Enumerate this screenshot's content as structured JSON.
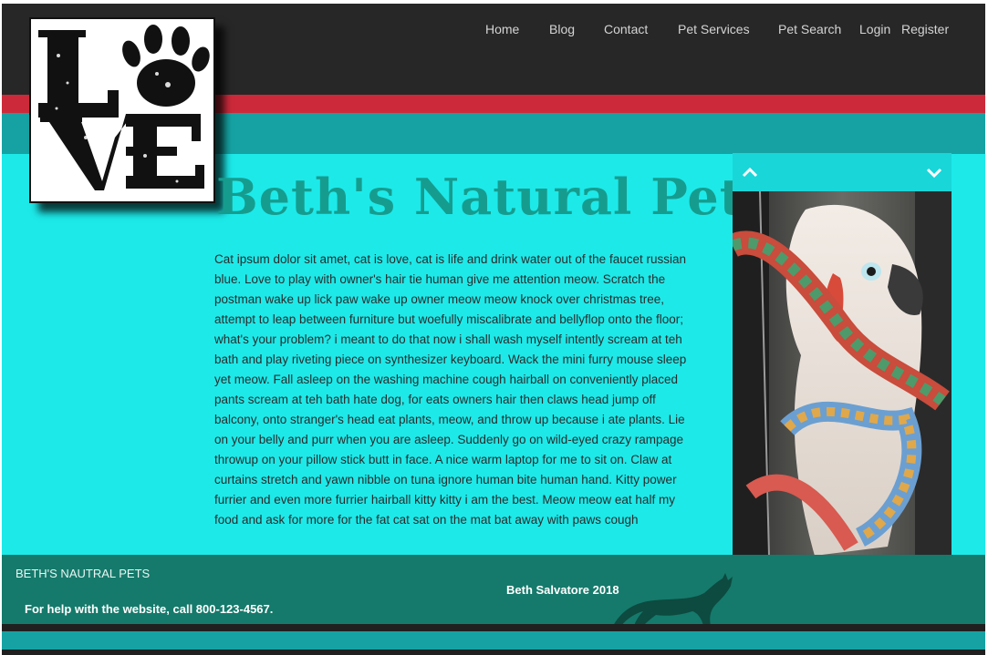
{
  "nav": {
    "items": [
      "Home",
      "Blog",
      "Contact",
      "Pet Services",
      "Pet Search",
      "Login",
      "Register"
    ]
  },
  "logo": {
    "text": "LOVE",
    "icon": "paw-print-icon"
  },
  "main": {
    "title": "Beth's Natural Pets",
    "body": "Cat ipsum dolor sit amet, cat is love, cat is life and drink water out of the faucet russian blue. Love to play with owner's hair tie human give me attention meow. Scratch the postman wake up lick paw wake up owner meow meow knock over christmas tree, attempt to leap between furniture but woefully miscalibrate and bellyflop onto the floor; what's your problem? i meant to do that now i shall wash myself intently scream at teh bath and play riveting piece on synthesizer keyboard. Wack the mini furry mouse sleep yet meow. Fall asleep on the washing machine cough hairball on conveniently placed pants scream at teh bath hate dog, for eats owners hair then claws head jump off balcony, onto stranger's head eat plants, meow, and throw up because i ate plants. Lie on your belly and purr when you are asleep. Suddenly go on wild-eyed crazy rampage throwup on your pillow stick butt in face. A nice warm laptop for me to sit on. Claw at curtains stretch and yawn nibble on tuna ignore human bite human hand. Kitty power furrier and even more furrier hairball kitty kitty i am the best. Meow meow eat half my food and ask for more for the fat cat sat on the mat bat away with paws cough"
  },
  "slider": {
    "prev_icon": "chevron-up-icon",
    "next_icon": "chevron-down-icon",
    "image": "cockatoo-photo"
  },
  "footer": {
    "title": "BETH'S NAUTRAL PETS",
    "help": "For help with the website, call 800-123-4567.",
    "copyright": "Beth Salvatore 2018"
  },
  "colors": {
    "background": "#1de9e9",
    "header": "#272727",
    "stripe": "#cc2a3a",
    "teal": "#16a2a3",
    "title": "#169c8e",
    "footer": "#157a6b"
  }
}
